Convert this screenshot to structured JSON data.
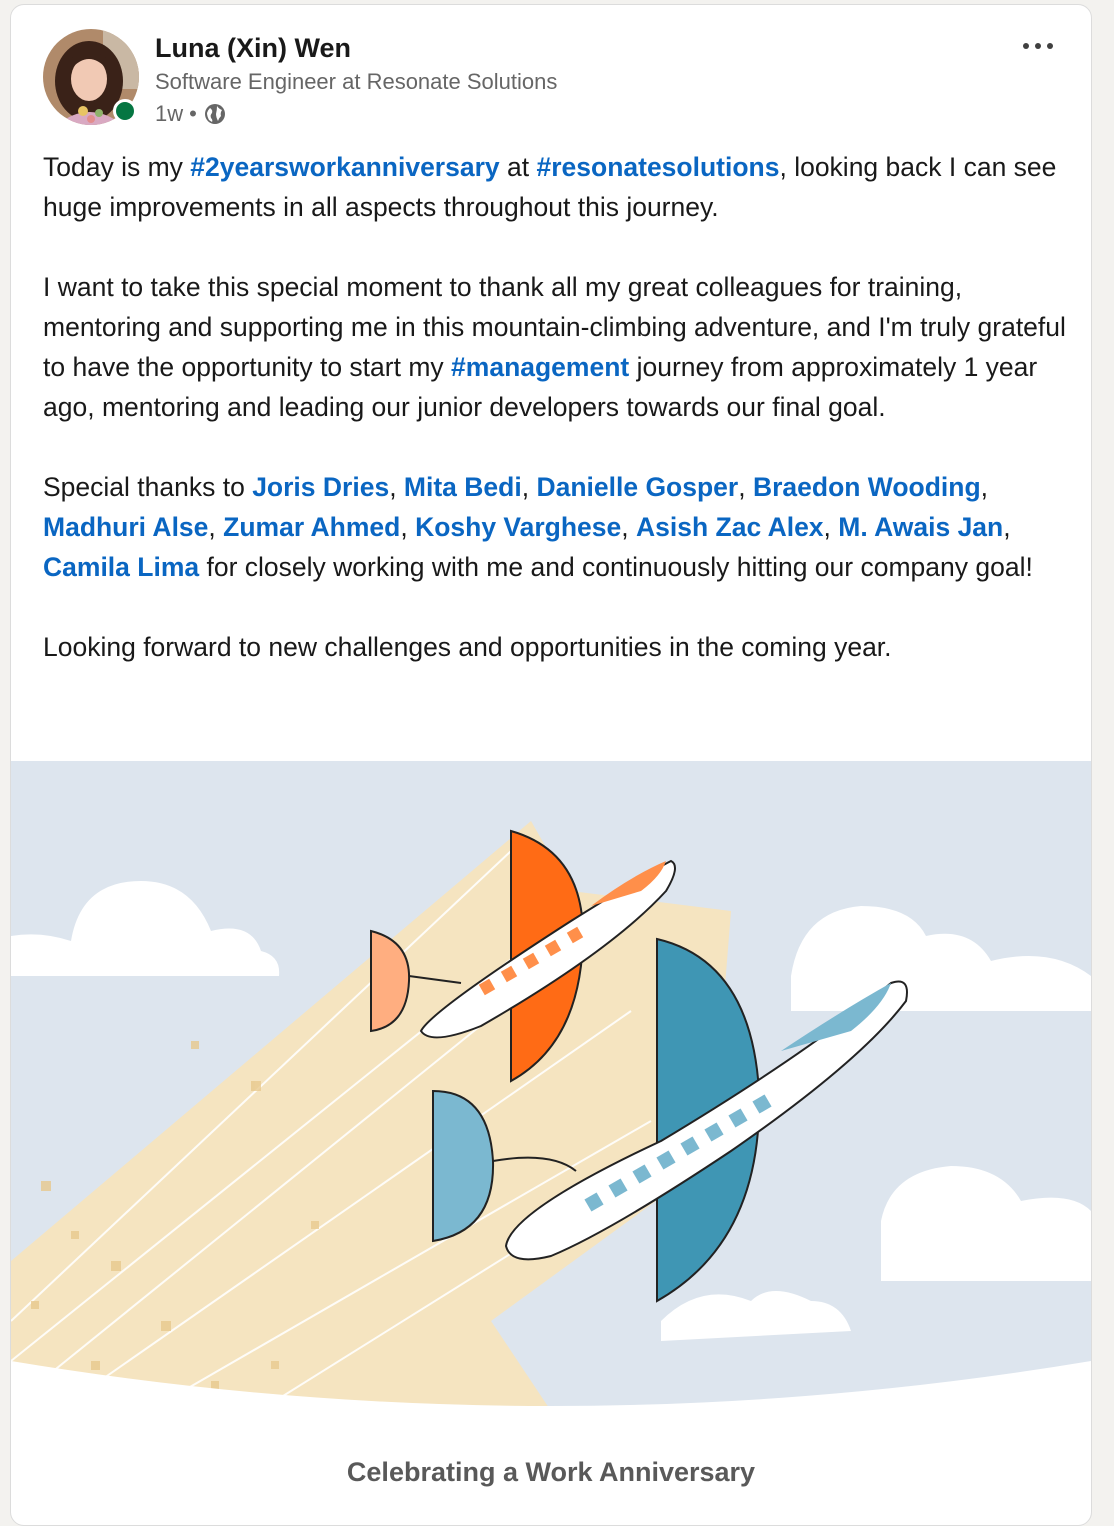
{
  "author": {
    "name": "Luna (Xin) Wen",
    "headline": "Software Engineer at Resonate Solutions",
    "time_ago": "1w",
    "separator": "•",
    "visibility_icon": "globe-icon",
    "presence_status": "online",
    "presence_color": "#057642"
  },
  "menu": {
    "more_icon": "more-horizontal-icon"
  },
  "post": {
    "p1": {
      "t1": "Today is my ",
      "tag1": "#2yearsworkanniversary",
      "t2": " at ",
      "tag2": "#resonatesolutions",
      "t3": ", looking back I can see huge improvements in all aspects throughout this journey."
    },
    "p2": {
      "t1": "I want to take this special moment to thank all my great colleagues for training, mentoring and supporting me in this mountain-climbing adventure, and I'm truly grateful to have the opportunity to start my ",
      "tag1": "#management",
      "t2": " journey from approximately 1 year ago, mentoring and leading our junior developers towards our final goal."
    },
    "p3": {
      "t1": "Special thanks to ",
      "mentions": [
        "Joris Dries",
        "Mita Bedi",
        "Danielle Gosper",
        "Braedon Wooding",
        "Madhuri Alse",
        "Zumar Ahmed",
        "Koshy Varghese",
        "Asish Zac Alex",
        "M. Awais Jan",
        "Camila Lima"
      ],
      "comma": ", ",
      "t2": " for closely working with me and continuously hitting our company goal!"
    },
    "p4": "Looking forward to new challenges and opportunities in the coming year."
  },
  "image": {
    "caption": "Celebrating a Work Anniversary",
    "colors": {
      "sky": "#dde5ee",
      "cloud": "#ffffff",
      "trail": "#f5e4c0",
      "orange": "#ff6b15",
      "orange_light": "#ffae80",
      "blue": "#3f96b4",
      "blue_light": "#7bb8d0"
    }
  },
  "colors": {
    "link": "#0a66c2",
    "text": "#191919",
    "muted": "#666666"
  }
}
